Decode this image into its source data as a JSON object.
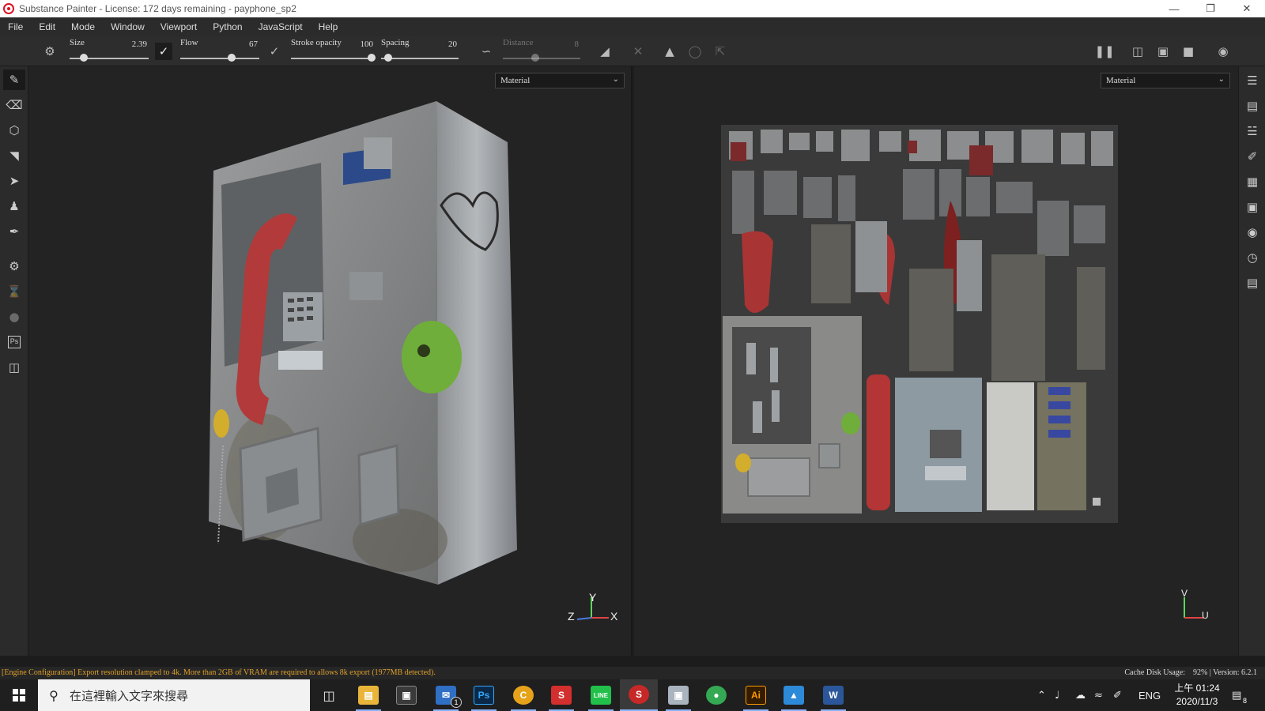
{
  "window": {
    "title": "Substance Painter - License: 172 days remaining - payphone_sp2",
    "controls": [
      "minimize",
      "restore",
      "close"
    ]
  },
  "menu": [
    "File",
    "Edit",
    "Mode",
    "Window",
    "Viewport",
    "Python",
    "JavaScript",
    "Help"
  ],
  "toolbar": {
    "size_label": "Size",
    "size_value": "2.39",
    "flow_label": "Flow",
    "flow_value": "67",
    "opacity_label": "Stroke opacity",
    "opacity_value": "100",
    "spacing_label": "Spacing",
    "spacing_value": "20",
    "distance_label": "Distance",
    "distance_value": "8"
  },
  "viewports": {
    "left_mode": "Material",
    "right_mode": "Material",
    "left_axes": {
      "y": "Y",
      "x": "X",
      "z": "Z"
    },
    "right_axes": {
      "v": "V",
      "u": "U"
    }
  },
  "status": {
    "warning": "[Engine Configuration] Export resolution clamped to 4k. More than 2GB of VRAM are required to allows 8k export (1977MB detected).",
    "cache_label": "Cache Disk Usage:",
    "cache_value": "92%",
    "version": "| Version: 6.2.1"
  },
  "taskbar": {
    "search_placeholder": "在這裡輸入文字來搜尋",
    "apps": [
      "task-view",
      "file-explorer",
      "store",
      "mail",
      "photoshop",
      "chrome-canary",
      "substance-designer",
      "line",
      "substance-painter",
      "image-viewer",
      "chrome",
      "illustrator",
      "photos",
      "word"
    ],
    "mail_badge": "1",
    "tray_lang": "ENG",
    "time": "上午 01:24",
    "date": "2020/11/3",
    "notification_count": "8"
  },
  "colors": {
    "accent": "#8ab4f8",
    "warning": "#e0a12a",
    "brand": "#dd1122"
  }
}
